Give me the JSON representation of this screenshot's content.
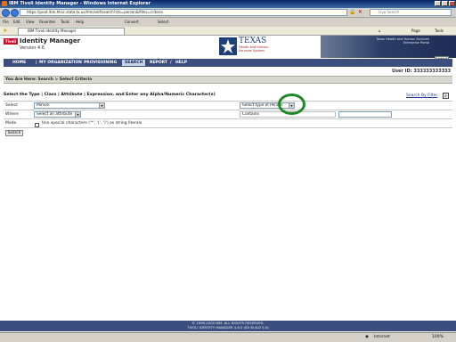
{
  "window": {
    "title": "IBM Tivoli Identity Manager - Windows Internet Explorer"
  },
  "browser": {
    "address": "https://prod.itim.hhsc.state.tx.us/itim/self/search?ctx=person&filter=criteria",
    "search_placeholder": "Live Search",
    "menu": [
      "File",
      "Edit",
      "View",
      "Favorites",
      "Tools",
      "Help"
    ],
    "convert_label": "Convert",
    "select_label": "Select",
    "tab_label": "IBM Tivoli Identity Manager",
    "toolbar": {
      "page": "Page",
      "tools": "Tools"
    }
  },
  "banner": {
    "tivoli_badge": "Tivoli",
    "product": "Identity Manager",
    "version": "Version 4.6",
    "texas": "TEXAS",
    "texas_sub": "Health and Human Services System",
    "hhs_text": "Texas Health and Human Services Enterprise Portal",
    "logout": "Logout"
  },
  "nav": {
    "items": [
      "HOME",
      "MY ORGANIZATION",
      "PROVISIONING",
      "SEARCH",
      "REPORT",
      "HELP"
    ],
    "active": "SEARCH"
  },
  "user_id": "User ID: 333333333333",
  "breadcrumb": "You Are Here: Search > Select Criteria",
  "section": {
    "title": "Select the Type | Class | Attribute | Expression, and Enter any Alpha/Numeric Character(s)",
    "search_by_filter": "Search By Filter"
  },
  "form": {
    "select_label": "Select",
    "select_value": "Person",
    "type_value": "Select type of Person",
    "where_label": "Where",
    "attribute_value": "Select an attribute",
    "expression_value": "Contains",
    "mode_label": "Mode",
    "special_chars_label": "Use special characters ('*', '(', ')') as string literals",
    "search_button": "Search"
  },
  "footer": {
    "line1": "© 1999-2005 IBM. ALL RIGHTS RESERVED.",
    "line2": "TIVOLI IDENTITY MANAGER 4.6.0 (IDI BUILD 5.6)"
  },
  "status": {
    "zone": "Internet",
    "zoom": "100%"
  }
}
